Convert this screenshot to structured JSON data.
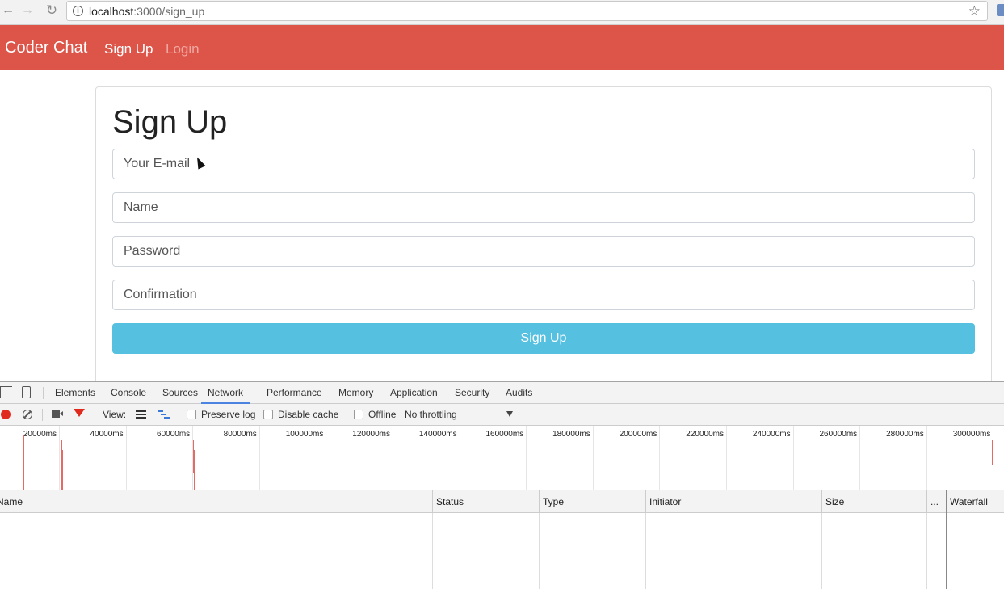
{
  "browser": {
    "url_host": "localhost",
    "url_path": ":3000/sign_up"
  },
  "navbar": {
    "brand": "Coder Chat",
    "links": [
      {
        "label": "Sign Up",
        "active": true
      },
      {
        "label": "Login",
        "active": false
      }
    ],
    "color": "#dd5449"
  },
  "form": {
    "title": "Sign Up",
    "email_placeholder": "Your E-mail",
    "name_placeholder": "Name",
    "password_placeholder": "Password",
    "confirmation_placeholder": "Confirmation",
    "submit_label": "Sign Up",
    "submit_color": "#55c0e0"
  },
  "devtools": {
    "tabs": [
      "Elements",
      "Console",
      "Sources",
      "Network",
      "Performance",
      "Memory",
      "Application",
      "Security",
      "Audits"
    ],
    "active_tab": "Network",
    "toolbar": {
      "view_label": "View:",
      "preserve_log": "Preserve log",
      "disable_cache": "Disable cache",
      "offline": "Offline",
      "throttling": "No throttling"
    },
    "timeline_ticks": [
      "20000ms",
      "40000ms",
      "60000ms",
      "80000ms",
      "100000ms",
      "120000ms",
      "140000ms",
      "160000ms",
      "180000ms",
      "200000ms",
      "220000ms",
      "240000ms",
      "260000ms",
      "280000ms",
      "300000ms"
    ],
    "columns": [
      "Name",
      "Status",
      "Type",
      "Initiator",
      "Size",
      "...",
      "Waterfall"
    ]
  }
}
